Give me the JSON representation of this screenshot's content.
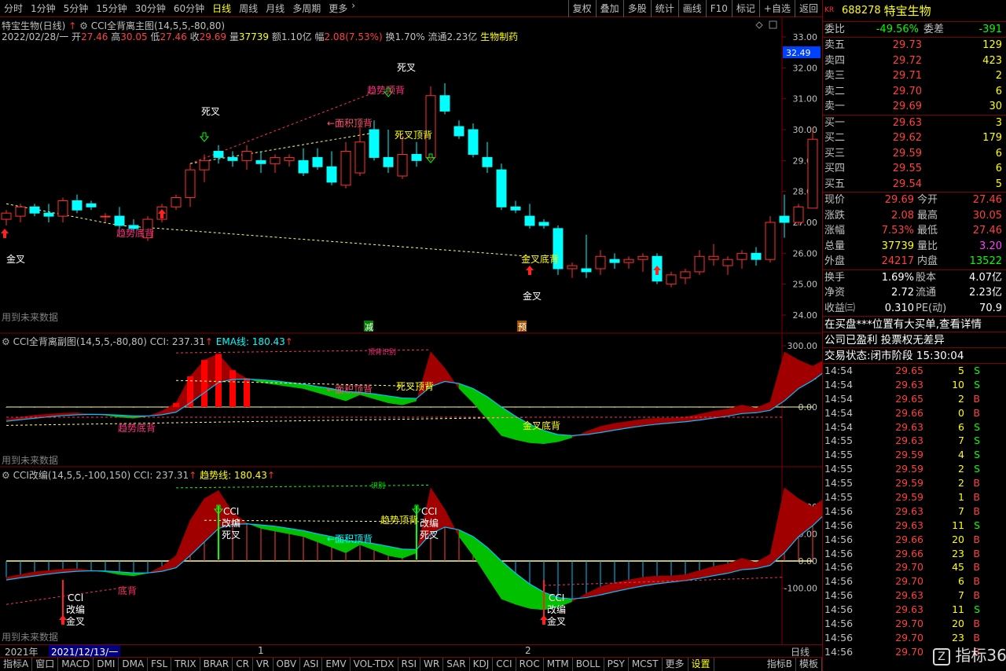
{
  "toolbar": {
    "periods": [
      "分时",
      "1分钟",
      "5分钟",
      "15分钟",
      "30分钟",
      "60分钟",
      "日线",
      "周线",
      "月线",
      "多周期",
      "更多"
    ],
    "active_period": "日线",
    "right_tools": [
      "复权",
      "叠加",
      "多股",
      "统计",
      "画线",
      "F10",
      "标记",
      "+自选",
      "返回"
    ]
  },
  "main_chart": {
    "stock_label": "特宝生物(日线)",
    "indicator_label": "CCI全背离主图(14,5,5,-80,80)",
    "ohlc_line": {
      "date": "2022/02/28/一",
      "open_label": "开",
      "open": "27.46",
      "high_label": "高",
      "high": "30.05",
      "low_label": "低",
      "low": "27.46",
      "close_label": "收",
      "close": "29.69",
      "vol_label": "量",
      "vol": "37739",
      "amt_label": "额",
      "amt": "1.10亿",
      "chg_label": "幅",
      "chg": "2.08(7.53%)",
      "turnover_label": "换",
      "turnover": "1.70%",
      "float_label": "流通",
      "float": "2.23亿",
      "industry": "生物制药"
    },
    "price_ticks": [
      "33.00",
      "32.00",
      "31.00",
      "30.00",
      "29.00",
      "28.00",
      "27.00",
      "26.00",
      "25.00",
      "24.00"
    ],
    "current_price_tag": "32.49",
    "labels": {
      "death_cross_1": "死叉",
      "death_cross_2": "死叉",
      "golden_cross_1": "金叉",
      "golden_cross_2": "金叉",
      "area_top": "←面积顶背",
      "trend_top": "趋势顶背",
      "dead_top": "死叉顶背",
      "trend_bottom": "趋势底背",
      "gold_bottom": "金叉底背",
      "future": "用到未来数据",
      "reduce": "减",
      "predict": "预"
    }
  },
  "sub1": {
    "title": "CCI全背离副图(14,5,5,-80,80)",
    "cci_label": "CCI: 237.31",
    "ema_label": "EMA线: 180.43",
    "ticks": [
      "300.00",
      "150.00",
      "0.00"
    ],
    "labels": {
      "area_top": "←面积顶背",
      "dead_top": "死叉顶背",
      "trend_bottom": "趋势底背",
      "gold_bottom": "金叉底背",
      "top_tag": "顶背识别",
      "future": "用到未来数据"
    }
  },
  "sub2": {
    "title": "CCI改编(14,5,5,-100,150)",
    "cci_label": "CCI: 237.31",
    "trend_label": "趋势线: 180.43",
    "ticks": [
      "200.00",
      "100.00",
      "0.00",
      "-100.00"
    ],
    "labels": {
      "cci": "CCI",
      "mod": "改编",
      "dead": "死叉",
      "gold": "金叉",
      "area_top": "←面积顶背",
      "trend_top": "趋势顶背",
      "bottom": "底背",
      "recog": "识别",
      "future": "用到未来数据"
    }
  },
  "date_axis": {
    "year": "2021年",
    "cursor_date": "2021/12/13/一",
    "month_1": "1",
    "month_2": "2",
    "right": "日线"
  },
  "bottom_bar": {
    "buttons": [
      "指标A",
      "窗口",
      "MACD",
      "DMI",
      "DMA",
      "FSL",
      "TRIX",
      "BRAR",
      "CR",
      "VR",
      "OBV",
      "ASI",
      "EMV",
      "VOL-TDX",
      "RSI",
      "WR",
      "SAR",
      "KDJ",
      "CCI",
      "ROC",
      "MTM",
      "BOLL",
      "PSY",
      "MCST",
      "更多",
      "设置"
    ],
    "active": "设置",
    "right_buttons": [
      "指标B",
      "模板"
    ]
  },
  "quote": {
    "market": "KR",
    "code": "688278",
    "name": "特宝生物",
    "wei_bi_label": "委比",
    "wei_bi": "-49.56%",
    "wei_cha_label": "委差",
    "wei_cha": "-391",
    "asks": [
      {
        "label": "卖五",
        "price": "29.73",
        "vol": "129"
      },
      {
        "label": "卖四",
        "price": "29.72",
        "vol": "423"
      },
      {
        "label": "卖三",
        "price": "29.71",
        "vol": "2"
      },
      {
        "label": "卖二",
        "price": "29.70",
        "vol": "6"
      },
      {
        "label": "卖一",
        "price": "29.69",
        "vol": "30"
      }
    ],
    "bids": [
      {
        "label": "买一",
        "price": "29.63",
        "vol": "3"
      },
      {
        "label": "买二",
        "price": "29.62",
        "vol": "179"
      },
      {
        "label": "买三",
        "price": "29.59",
        "vol": "6"
      },
      {
        "label": "买四",
        "price": "29.55",
        "vol": "6"
      },
      {
        "label": "买五",
        "price": "29.54",
        "vol": "5"
      }
    ],
    "stats": [
      {
        "l1": "现价",
        "v1": "29.69",
        "l2": "今开",
        "v2": "27.46",
        "c1": "#ff4040",
        "c2": "#ff4040"
      },
      {
        "l1": "涨跌",
        "v1": "2.08",
        "l2": "最高",
        "v2": "30.05",
        "c1": "#ff4040",
        "c2": "#ff4040"
      },
      {
        "l1": "涨幅",
        "v1": "7.53%",
        "l2": "最低",
        "v2": "27.46",
        "c1": "#ff4040",
        "c2": "#ff4040"
      },
      {
        "l1": "总量",
        "v1": "37739",
        "l2": "量比",
        "v2": "3.20",
        "c1": "#ffff00",
        "c2": "#ff40ff"
      },
      {
        "l1": "外盘",
        "v1": "24217",
        "l2": "内盘",
        "v2": "13522",
        "c1": "#ff4040",
        "c2": "#00ff00"
      }
    ],
    "stats2": [
      {
        "l1": "换手",
        "v1": "1.69%",
        "l2": "股本",
        "v2": "4.07亿"
      },
      {
        "l1": "净资",
        "v1": "2.72",
        "l2": "流通",
        "v2": "2.23亿"
      },
      {
        "l1": "收益㈢",
        "v1": "0.310",
        "l2": "PE(动)",
        "v2": "70.9"
      }
    ],
    "notice1": "在买盘***位置有大买单,查看详情",
    "notice2": "公司已盈利 投票权无差异",
    "status_label": "交易状态:",
    "status": "闭市阶段 15:30:04",
    "trades": [
      {
        "t": "14:54",
        "p": "29.65",
        "v": "5",
        "s": "S"
      },
      {
        "t": "14:54",
        "p": "29.63",
        "v": "10",
        "s": "S"
      },
      {
        "t": "14:54",
        "p": "29.65",
        "v": "2",
        "s": "B"
      },
      {
        "t": "14:54",
        "p": "29.66",
        "v": "0",
        "s": "B"
      },
      {
        "t": "14:54",
        "p": "29.63",
        "v": "6",
        "s": "S"
      },
      {
        "t": "14:55",
        "p": "29.63",
        "v": "7",
        "s": "S"
      },
      {
        "t": "14:55",
        "p": "29.59",
        "v": "4",
        "s": "S"
      },
      {
        "t": "14:55",
        "p": "29.59",
        "v": "2",
        "s": "S"
      },
      {
        "t": "14:55",
        "p": "29.59",
        "v": "2",
        "s": "B"
      },
      {
        "t": "14:55",
        "p": "29.59",
        "v": "1",
        "s": "B"
      },
      {
        "t": "14:56",
        "p": "29.63",
        "v": "7",
        "s": "B"
      },
      {
        "t": "14:56",
        "p": "29.63",
        "v": "11",
        "s": "S"
      },
      {
        "t": "14:56",
        "p": "29.66",
        "v": "20",
        "s": "B"
      },
      {
        "t": "14:56",
        "p": "29.66",
        "v": "23",
        "s": "B"
      },
      {
        "t": "14:56",
        "p": "29.70",
        "v": "45",
        "s": "B"
      },
      {
        "t": "14:56",
        "p": "29.70",
        "v": "6",
        "s": "B"
      },
      {
        "t": "14:56",
        "p": "29.63",
        "v": "7",
        "s": "B"
      },
      {
        "t": "14:56",
        "p": "29.63",
        "v": "11",
        "s": "S"
      },
      {
        "t": "14:56",
        "p": "29.70",
        "v": "20",
        "s": "B"
      },
      {
        "t": "14:56",
        "p": "29.70",
        "v": "23",
        "s": "B"
      },
      {
        "t": "14:56",
        "p": "29.70",
        "v": "",
        "s": "B"
      }
    ],
    "watermark": "指标365"
  },
  "candles": [
    {
      "o": 27.1,
      "h": 27.4,
      "l": 26.9,
      "c": 27.3
    },
    {
      "o": 27.2,
      "h": 27.6,
      "l": 27.0,
      "c": 27.5
    },
    {
      "o": 27.5,
      "h": 27.6,
      "l": 27.2,
      "c": 27.3
    },
    {
      "o": 27.3,
      "h": 27.6,
      "l": 27.0,
      "c": 27.2
    },
    {
      "o": 27.2,
      "h": 27.8,
      "l": 27.0,
      "c": 27.7
    },
    {
      "o": 27.7,
      "h": 27.9,
      "l": 27.3,
      "c": 27.4
    },
    {
      "o": 27.6,
      "h": 27.7,
      "l": 27.4,
      "c": 27.5
    },
    {
      "o": 27.2,
      "h": 27.3,
      "l": 27.0,
      "c": 27.2
    },
    {
      "o": 27.2,
      "h": 27.5,
      "l": 26.8,
      "c": 26.9
    },
    {
      "o": 26.9,
      "h": 27.1,
      "l": 26.7,
      "c": 26.8
    },
    {
      "o": 26.5,
      "h": 27.2,
      "l": 26.4,
      "c": 27.1
    },
    {
      "o": 27.1,
      "h": 27.6,
      "l": 27.0,
      "c": 27.5
    },
    {
      "o": 27.5,
      "h": 27.9,
      "l": 27.4,
      "c": 27.8
    },
    {
      "o": 27.8,
      "h": 28.9,
      "l": 27.5,
      "c": 28.7
    },
    {
      "o": 28.7,
      "h": 29.2,
      "l": 28.3,
      "c": 29.0
    },
    {
      "o": 29.3,
      "h": 29.5,
      "l": 28.9,
      "c": 29.1
    },
    {
      "o": 29.1,
      "h": 29.3,
      "l": 28.8,
      "c": 29.0
    },
    {
      "o": 29.0,
      "h": 29.5,
      "l": 28.7,
      "c": 29.3
    },
    {
      "o": 29.0,
      "h": 29.3,
      "l": 28.6,
      "c": 28.9
    },
    {
      "o": 28.9,
      "h": 29.2,
      "l": 28.6,
      "c": 29.1
    },
    {
      "o": 29.0,
      "h": 29.2,
      "l": 28.8,
      "c": 29.1
    },
    {
      "o": 29.0,
      "h": 29.4,
      "l": 28.5,
      "c": 28.6
    },
    {
      "o": 29.1,
      "h": 29.4,
      "l": 28.7,
      "c": 28.8
    },
    {
      "o": 28.8,
      "h": 29.3,
      "l": 28.2,
      "c": 28.3
    },
    {
      "o": 28.2,
      "h": 29.6,
      "l": 28.1,
      "c": 29.3
    },
    {
      "o": 28.6,
      "h": 30.2,
      "l": 28.5,
      "c": 29.6
    },
    {
      "o": 30.0,
      "h": 30.3,
      "l": 29.0,
      "c": 29.1
    },
    {
      "o": 29.1,
      "h": 30.0,
      "l": 28.6,
      "c": 28.8
    },
    {
      "o": 28.5,
      "h": 29.8,
      "l": 28.4,
      "c": 29.2
    },
    {
      "o": 29.2,
      "h": 29.6,
      "l": 28.8,
      "c": 29.0
    },
    {
      "o": 29.1,
      "h": 31.4,
      "l": 29.0,
      "c": 31.1
    },
    {
      "o": 31.1,
      "h": 31.5,
      "l": 30.5,
      "c": 30.6
    },
    {
      "o": 30.1,
      "h": 30.3,
      "l": 29.7,
      "c": 29.8
    },
    {
      "o": 30.0,
      "h": 30.2,
      "l": 29.1,
      "c": 29.2
    },
    {
      "o": 29.1,
      "h": 29.6,
      "l": 28.6,
      "c": 28.8
    },
    {
      "o": 28.7,
      "h": 28.9,
      "l": 27.4,
      "c": 27.5
    },
    {
      "o": 27.5,
      "h": 27.7,
      "l": 27.3,
      "c": 27.4
    },
    {
      "o": 27.2,
      "h": 27.6,
      "l": 26.8,
      "c": 26.9
    },
    {
      "o": 27.0,
      "h": 27.1,
      "l": 26.8,
      "c": 26.9
    },
    {
      "o": 26.8,
      "h": 26.9,
      "l": 25.3,
      "c": 25.5
    },
    {
      "o": 25.5,
      "h": 25.7,
      "l": 25.2,
      "c": 25.6
    },
    {
      "o": 25.5,
      "h": 26.6,
      "l": 25.2,
      "c": 25.4
    },
    {
      "o": 25.5,
      "h": 26.1,
      "l": 25.3,
      "c": 25.9
    },
    {
      "o": 25.8,
      "h": 26.0,
      "l": 25.5,
      "c": 25.7
    },
    {
      "o": 25.7,
      "h": 25.9,
      "l": 25.5,
      "c": 25.8
    },
    {
      "o": 25.8,
      "h": 26.0,
      "l": 25.4,
      "c": 25.9
    },
    {
      "o": 25.9,
      "h": 26.0,
      "l": 25.0,
      "c": 25.1
    },
    {
      "o": 25.0,
      "h": 25.4,
      "l": 24.9,
      "c": 25.3
    },
    {
      "o": 25.2,
      "h": 25.5,
      "l": 25.0,
      "c": 25.4
    },
    {
      "o": 25.4,
      "h": 26.1,
      "l": 25.3,
      "c": 25.9
    },
    {
      "o": 25.8,
      "h": 26.3,
      "l": 25.6,
      "c": 25.9
    },
    {
      "o": 25.6,
      "h": 25.9,
      "l": 25.3,
      "c": 25.8
    },
    {
      "o": 25.8,
      "h": 26.1,
      "l": 25.5,
      "c": 26.0
    },
    {
      "o": 26.0,
      "h": 26.2,
      "l": 25.6,
      "c": 25.8
    },
    {
      "o": 25.8,
      "h": 27.2,
      "l": 25.7,
      "c": 27.0
    },
    {
      "o": 27.2,
      "h": 27.9,
      "l": 26.5,
      "c": 27.0
    },
    {
      "o": 27.0,
      "h": 27.6,
      "l": 26.9,
      "c": 27.5
    },
    {
      "o": 27.46,
      "h": 30.05,
      "l": 27.46,
      "c": 29.69
    }
  ]
}
